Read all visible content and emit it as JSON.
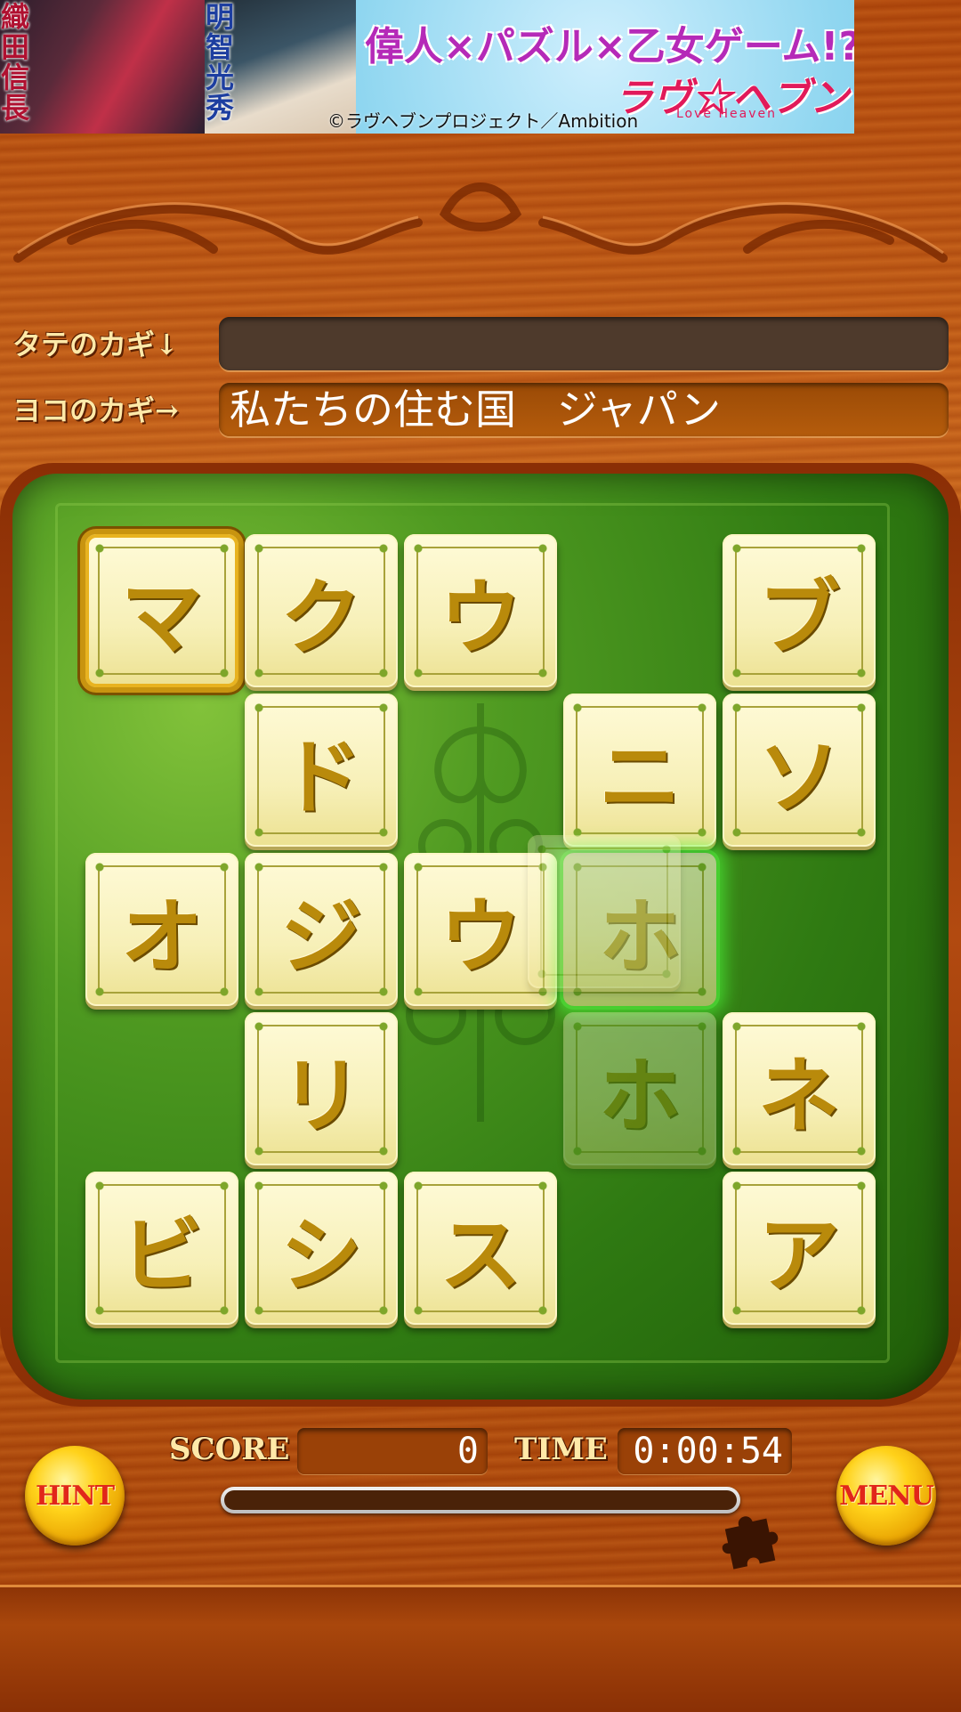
{
  "banner": {
    "name_left": "織田信長",
    "name_right": "明智光秀",
    "tagline": "偉人×パズル×乙女ゲーム!?",
    "copyright": "©ラヴヘブンプロジェクト／Ambition",
    "logo": "ラヴ☆ヘブン",
    "logo_sub": "Love Heaven"
  },
  "clues": {
    "vertical_label": "タテのカギ↓",
    "vertical_text": "",
    "horizontal_label": "ヨコのカギ→",
    "horizontal_text": "私たちの住む国　ジャパン"
  },
  "board": {
    "rows": 5,
    "cols": 5,
    "tiles": [
      {
        "row": 0,
        "col": 0,
        "char": "マ",
        "state": "selected"
      },
      {
        "row": 0,
        "col": 1,
        "char": "ク",
        "state": "normal"
      },
      {
        "row": 0,
        "col": 2,
        "char": "ウ",
        "state": "normal"
      },
      {
        "row": 0,
        "col": 4,
        "char": "ブ",
        "state": "normal"
      },
      {
        "row": 1,
        "col": 1,
        "char": "ド",
        "state": "normal"
      },
      {
        "row": 1,
        "col": 3,
        "char": "ニ",
        "state": "normal"
      },
      {
        "row": 1,
        "col": 4,
        "char": "ソ",
        "state": "normal"
      },
      {
        "row": 2,
        "col": 0,
        "char": "オ",
        "state": "normal"
      },
      {
        "row": 2,
        "col": 1,
        "char": "ジ",
        "state": "normal"
      },
      {
        "row": 2,
        "col": 2,
        "char": "ウ",
        "state": "normal"
      },
      {
        "row": 2,
        "col": 3,
        "char": "ホ",
        "state": "highlighted"
      },
      {
        "row": 3,
        "col": 1,
        "char": "リ",
        "state": "normal"
      },
      {
        "row": 3,
        "col": 3,
        "char": "ホ",
        "state": "ghost"
      },
      {
        "row": 3,
        "col": 4,
        "char": "ネ",
        "state": "normal"
      },
      {
        "row": 4,
        "col": 0,
        "char": "ビ",
        "state": "normal"
      },
      {
        "row": 4,
        "col": 1,
        "char": "シ",
        "state": "normal"
      },
      {
        "row": 4,
        "col": 2,
        "char": "ス",
        "state": "normal"
      },
      {
        "row": 4,
        "col": 4,
        "char": "ア",
        "state": "normal"
      }
    ]
  },
  "status": {
    "score_label": "SCORE",
    "score": "0",
    "time_label": "TIME",
    "time": "0:00:54",
    "progress": 0.0
  },
  "buttons": {
    "hint": "HINT",
    "menu": "MENU"
  },
  "icons": {
    "puzzle": "puzzle-piece-icon"
  }
}
